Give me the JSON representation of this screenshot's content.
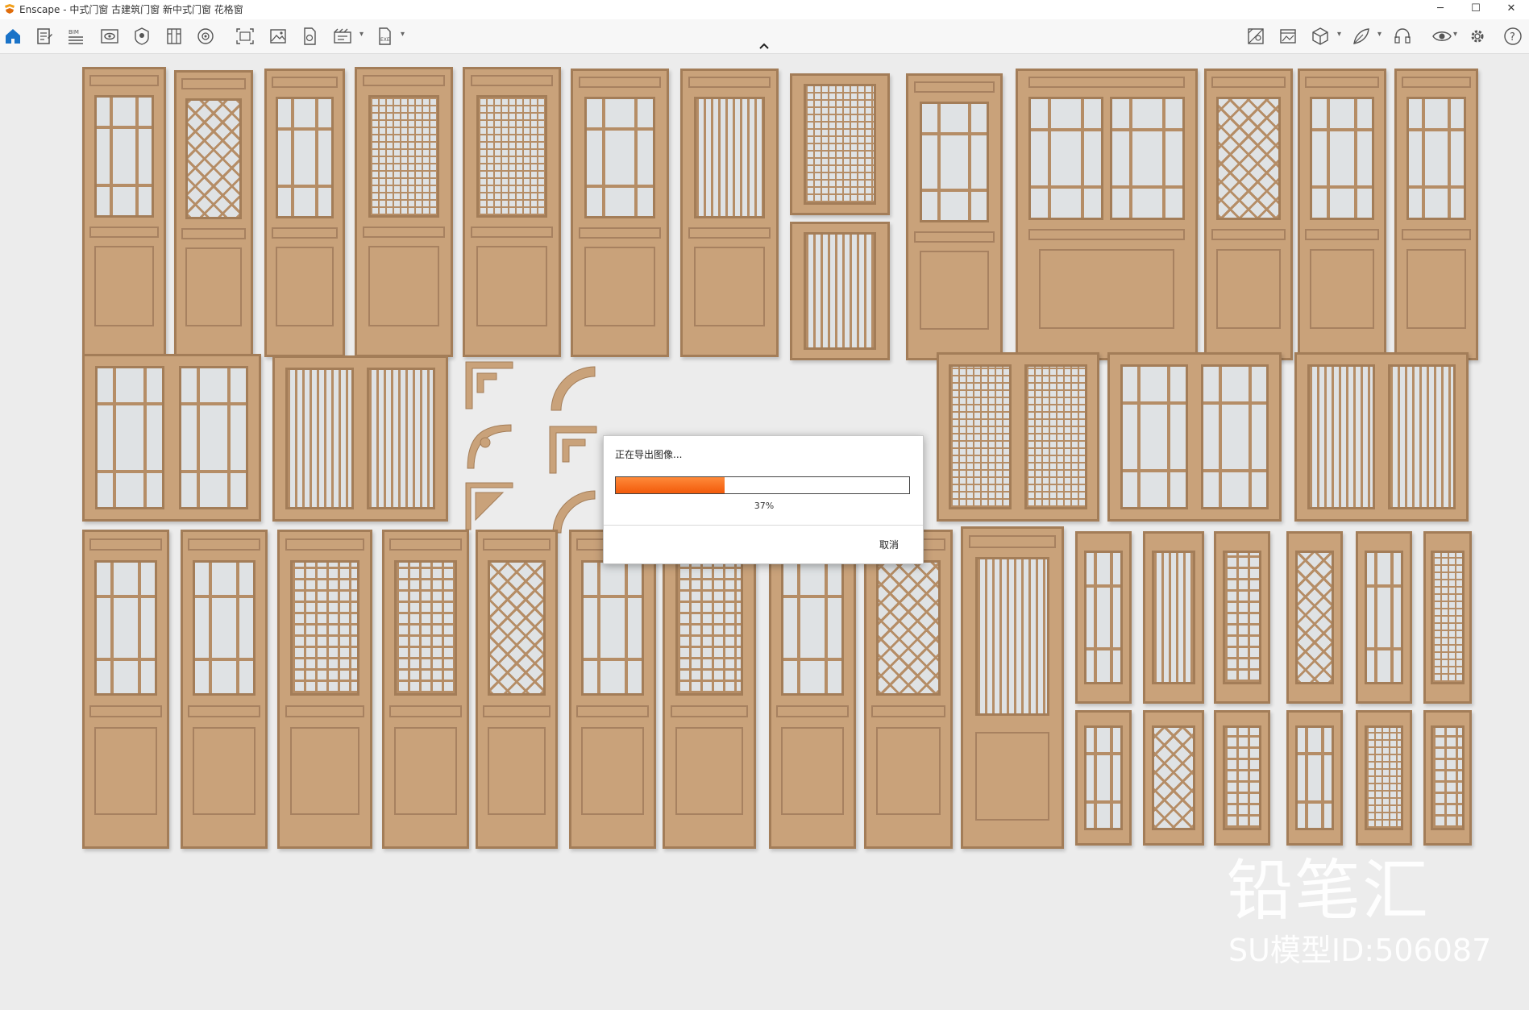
{
  "window": {
    "title": "Enscape - 中式门窗 古建筑门窗 新中式门窗 花格窗",
    "controls": [
      "─",
      "☐",
      "✕"
    ]
  },
  "toolbar": {
    "icons": [
      "home-icon",
      "document-icon",
      "bim-icon",
      "eye-frame-icon",
      "view-icon",
      "panel-icon",
      "sphere-icon",
      "capture-icon",
      "image-icon",
      "file-icon",
      "video-icon",
      "export-icon",
      "map-icon",
      "gallery-icon",
      "cube-icon",
      "leaf-icon",
      "headset-icon",
      "visibility-icon",
      "settings-icon",
      "help-icon"
    ],
    "accent": "#1a73c8"
  },
  "dialog": {
    "title": "正在导出图像...",
    "progress": 37,
    "progress_label": "37%",
    "cancel_label": "取消"
  },
  "watermark": {
    "brand": "铅笔汇",
    "model_id": "SU模型ID:506087"
  }
}
